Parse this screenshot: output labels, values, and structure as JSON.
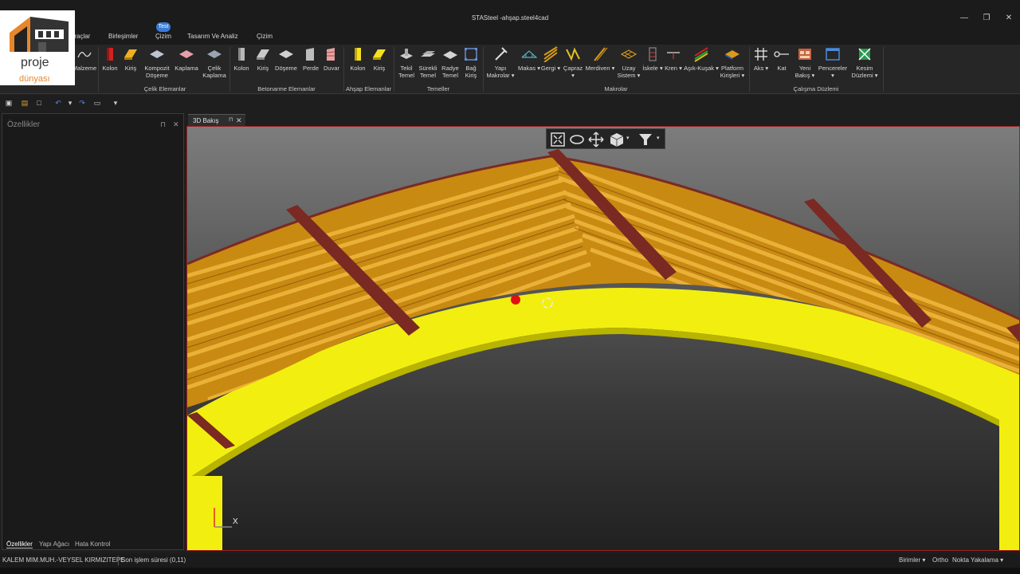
{
  "window": {
    "title": "STASteel -ahşap.steel4cad",
    "minimize": "—",
    "restore": "❐",
    "close": "✕"
  },
  "menu": {
    "tabs": [
      "Araçlar",
      "Birleşimler",
      "Çizim",
      "Tasarım Ve Analiz",
      "Çizim"
    ],
    "badge": "Test"
  },
  "logo": {
    "line1": "proje",
    "line2": "dünyası"
  },
  "ribbon": {
    "buttons": [
      {
        "label": "Malzeme",
        "icon": "material-icon"
      },
      {
        "label": "Kolon",
        "icon": "column-icon",
        "color": "#d42020"
      },
      {
        "label": "Kiriş",
        "icon": "beam-icon",
        "color": "#f0b020"
      },
      {
        "label": "Kompozit Döşeme",
        "icon": "composite-slab-icon"
      },
      {
        "label": "Kaplama",
        "icon": "cladding-icon"
      },
      {
        "label": "Çelik Kaplama",
        "icon": "steel-cladding-icon"
      },
      {
        "label": "Kolon",
        "icon": "concrete-column-icon"
      },
      {
        "label": "Kiriş",
        "icon": "concrete-beam-icon"
      },
      {
        "label": "Döşeme",
        "icon": "slab-icon"
      },
      {
        "label": "Perde",
        "icon": "shear-wall-icon"
      },
      {
        "label": "Duvar",
        "icon": "wall-icon"
      },
      {
        "label": "Kolon",
        "icon": "timber-column-icon"
      },
      {
        "label": "Kiriş",
        "icon": "timber-beam-icon"
      },
      {
        "label": "Tekil Temel",
        "icon": "single-footing-icon"
      },
      {
        "label": "Sürekli Temel",
        "icon": "strip-footing-icon"
      },
      {
        "label": "Radye Temel",
        "icon": "raft-footing-icon"
      },
      {
        "label": "Bağ Kiriş",
        "icon": "tie-beam-icon"
      },
      {
        "label": "Yapı Makrolar ▾",
        "icon": "structure-macro-icon"
      },
      {
        "label": "Makas ▾",
        "icon": "truss-icon"
      },
      {
        "label": "Gergi ▾",
        "icon": "tie-rod-icon"
      },
      {
        "label": "Çapraz ▾",
        "icon": "bracing-icon"
      },
      {
        "label": "Merdiven ▾",
        "icon": "stair-icon"
      },
      {
        "label": "Uzay Sistem ▾",
        "icon": "space-frame-icon"
      },
      {
        "label": "İskele ▾",
        "icon": "scaffold-icon"
      },
      {
        "label": "Kren ▾",
        "icon": "crane-icon"
      },
      {
        "label": "Aşık-Kuşak ▾",
        "icon": "purlin-icon"
      },
      {
        "label": "Platform Kirişleri ▾",
        "icon": "platform-beam-icon"
      },
      {
        "label": "Aks ▾",
        "icon": "grid-axis-icon"
      },
      {
        "label": "Kat",
        "icon": "floor-level-icon"
      },
      {
        "label": "Yeni Bakış ▾",
        "icon": "new-view-icon"
      },
      {
        "label": "Pencereler ▾",
        "icon": "windows-icon"
      },
      {
        "label": "Kesim Düzlemi ▾",
        "icon": "section-plane-icon"
      }
    ],
    "groups": [
      "Çelik Elemanlar",
      "Betonarme Elemanlar",
      "Ahşap Elemanlar",
      "Temeller",
      "Makrolar",
      "Çalışma Düzlemi"
    ]
  },
  "quick_access": {
    "icons": [
      "save-icon",
      "open-folder-icon",
      "new-file-icon",
      "undo-icon",
      "dropdown-icon",
      "redo-icon",
      "comment-icon",
      "customize-dropdown-icon"
    ],
    "glyphs": [
      "▣",
      "▤",
      "□",
      "↶",
      "▾",
      "↷",
      "▭",
      "▾"
    ]
  },
  "properties_panel": {
    "title": "Özellikler",
    "pin": "⊓",
    "close": "✕",
    "tabs": [
      "Özellikler",
      "Yapı Ağacı",
      "Hata Kontrol"
    ]
  },
  "view_tab": {
    "label": "3D Bakış",
    "pin": "⊓",
    "close": "✕"
  },
  "viewport": {
    "toolbar": [
      "zoom-extents-icon",
      "orbit-icon",
      "pan-icon",
      "view-cube-icon",
      "filter-icon"
    ],
    "axis_label": "X",
    "colors": {
      "timber": "#d99a1a",
      "steel_beam": "#7a2a22",
      "curved_beam": "#f2ef10",
      "marker": "#e01010"
    }
  },
  "status_bar": {
    "user": "KALEM MIM.MUH.-VEYSEL KIRMIZITEPE",
    "last_op": "Son işlem süresi (0,11)",
    "units": "Birimler ▾",
    "ortho": "Ortho",
    "snap": "Nokta Yakalama ▾"
  }
}
